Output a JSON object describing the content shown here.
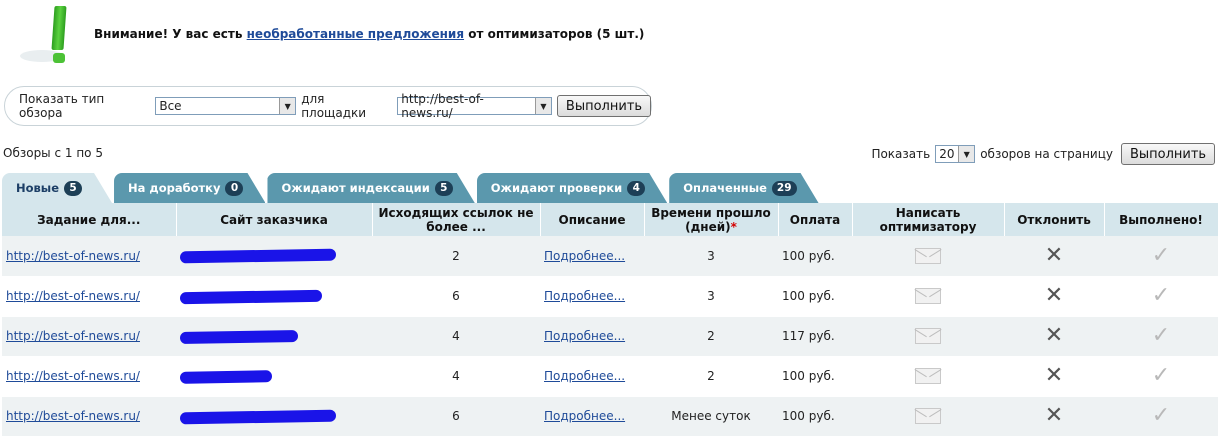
{
  "notice": {
    "prefix": "Внимание! У вас есть",
    "link": "необработанные предложения",
    "suffix": "от оптимизаторов (5 шт.)",
    "icon": "exclamation-icon",
    "icon_color": "#4cc236"
  },
  "filter": {
    "label_type": "Показать тип обзора",
    "type_value": "Все",
    "label_site": "для площадки",
    "site_value": "http://best-of-news.ru/",
    "submit": "Выполнить"
  },
  "range_text": "Обзоры с 1 по 5",
  "perpage": {
    "label_before": "Показать",
    "value": "20",
    "label_after": "обзоров на страницу",
    "submit": "Выполнить"
  },
  "tabs": [
    {
      "label": "Новые",
      "count": "5"
    },
    {
      "label": "На доработку",
      "count": "0"
    },
    {
      "label": "Ожидают индексации",
      "count": "5"
    },
    {
      "label": "Ожидают проверки",
      "count": "4"
    },
    {
      "label": "Оплаченные",
      "count": "29"
    }
  ],
  "columns": [
    "Задание для...",
    "Сайт заказчика",
    "Исходящих ссылок не более ...",
    "Описание",
    "Времени прошло (дней)",
    "Оплата",
    "Написать оптимизатору",
    "Отклонить",
    "Выполнено!"
  ],
  "required_mark": "*",
  "rows": [
    {
      "task": "http://best-of-news.ru/",
      "links": "2",
      "desc": "Подробнее...",
      "days": "3",
      "pay": "100 руб."
    },
    {
      "task": "http://best-of-news.ru/",
      "links": "6",
      "desc": "Подробнее...",
      "days": "3",
      "pay": "100 руб."
    },
    {
      "task": "http://best-of-news.ru/",
      "links": "4",
      "desc": "Подробнее...",
      "days": "2",
      "pay": "117 руб."
    },
    {
      "task": "http://best-of-news.ru/",
      "links": "4",
      "desc": "Подробнее...",
      "days": "2",
      "pay": "100 руб."
    },
    {
      "task": "http://best-of-news.ru/",
      "links": "6",
      "desc": "Подробнее...",
      "days": "Менее суток",
      "pay": "100 руб."
    }
  ],
  "icons": {
    "message": "envelope-icon",
    "reject": "close-icon",
    "done": "checkmark-icon"
  },
  "colors": {
    "tab": "#5b98ad",
    "tab_active": "#d5e6ec",
    "badge": "#1d3f56",
    "link": "#1f4b99",
    "redaction": "#1a14e8"
  }
}
